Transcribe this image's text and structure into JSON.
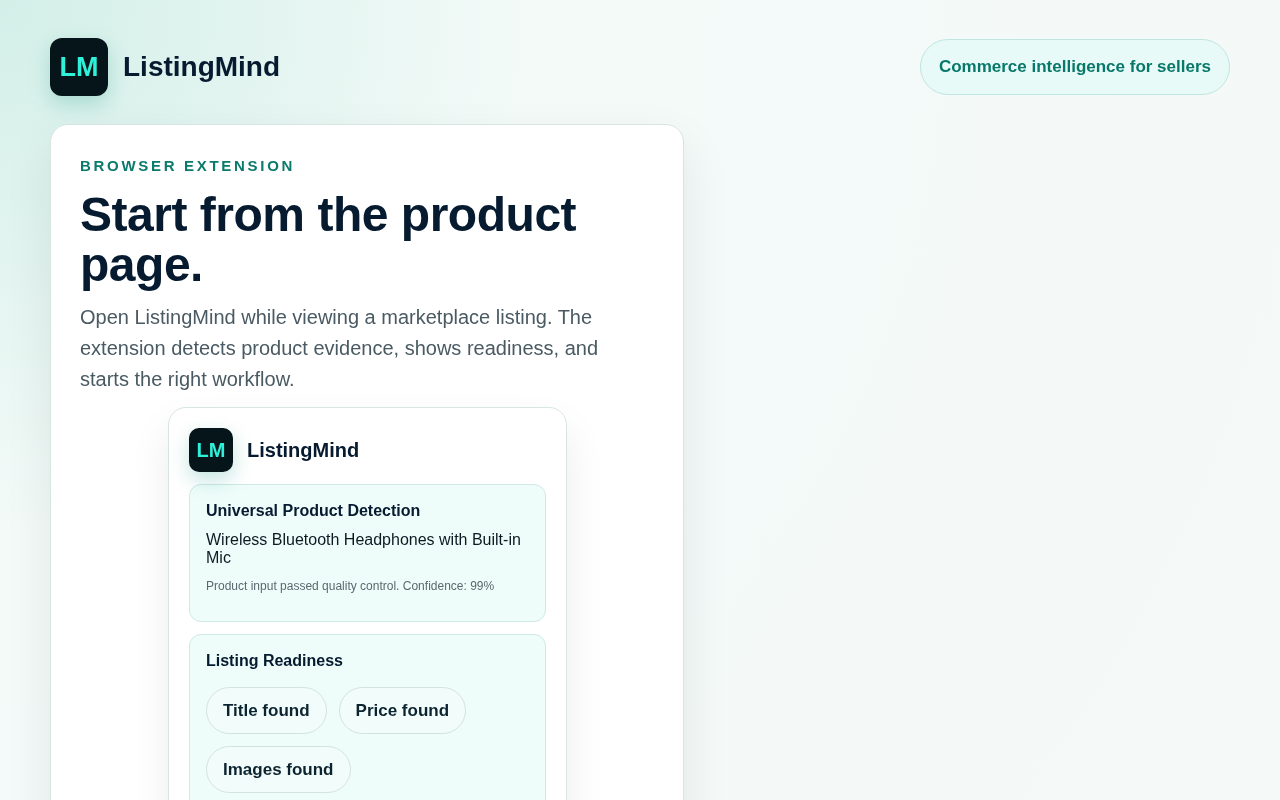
{
  "header": {
    "logo": "LM",
    "brand": "ListingMind",
    "tagline": "Commerce intelligence for sellers"
  },
  "hero": {
    "eyebrow": "BROWSER EXTENSION",
    "title": "Start from the product page.",
    "description": "Open ListingMind while viewing a marketplace listing. The extension detects product evidence, shows readiness, and starts the right workflow."
  },
  "popup": {
    "logo": "LM",
    "brand": "ListingMind",
    "detection": {
      "title": "Universal Product Detection",
      "product": "Wireless Bluetooth Headphones with Built-in Mic",
      "note": "Product input passed quality control. Confidence: 99%"
    },
    "readiness": {
      "title": "Listing Readiness",
      "chips": [
        "Title found",
        "Price found",
        "Images found"
      ]
    }
  }
}
